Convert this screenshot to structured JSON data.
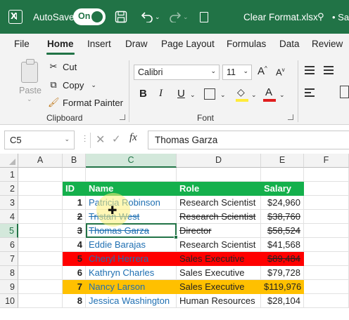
{
  "titlebar": {
    "autosave_label": "AutoSave",
    "autosave_state": "On",
    "filename": "Clear Format.xlsx",
    "saved_label": "• Save"
  },
  "tabs": [
    "File",
    "Home",
    "Insert",
    "Draw",
    "Page Layout",
    "Formulas",
    "Data",
    "Review"
  ],
  "active_tab": "Home",
  "ribbon": {
    "clipboard": {
      "paste_label": "Paste",
      "cut_label": "Cut",
      "copy_label": "Copy",
      "format_painter_label": "Format Painter",
      "group_label": "Clipboard"
    },
    "font": {
      "font_name": "Calibri",
      "font_size": "11",
      "grow_label": "A",
      "shrink_label": "A",
      "bold_label": "B",
      "italic_label": "I",
      "underline_label": "U",
      "fill_color": "#ffeb3b",
      "font_color": "#e01e1e",
      "group_label": "Font"
    }
  },
  "formula_bar": {
    "name_box": "C5",
    "fx_label": "fx",
    "value": "Thomas Garza"
  },
  "grid": {
    "columns": [
      "A",
      "B",
      "C",
      "D",
      "E",
      "F"
    ],
    "rows": [
      "1",
      "2",
      "3",
      "4",
      "5",
      "6",
      "7",
      "8",
      "9",
      "10"
    ],
    "selected_column": "C",
    "selected_row": "5",
    "header": {
      "id": "ID",
      "name": "Name",
      "role": "Role",
      "salary": "Salary"
    },
    "records": [
      {
        "id": "1",
        "name": "Patricia Robinson",
        "role": "Research Scientist",
        "salary": "$24,960"
      },
      {
        "id": "2",
        "name": "Tristan West",
        "role": "Research Scientist",
        "salary": "$38,760"
      },
      {
        "id": "3",
        "name": "Thomas Garza",
        "role": "Director",
        "salary": "$58,524"
      },
      {
        "id": "4",
        "name": "Eddie Barajas",
        "role": "Research Scientist",
        "salary": "$41,568"
      },
      {
        "id": "5",
        "name": "Cheryl Herrera",
        "role": "Sales Executive",
        "salary": "$89,484"
      },
      {
        "id": "6",
        "name": "Kathryn Charles",
        "role": "Sales Executive",
        "salary": "$79,728"
      },
      {
        "id": "7",
        "name": "Nancy Larson",
        "role": "Sales Executive",
        "salary": "$119,976"
      },
      {
        "id": "8",
        "name": "Jessica Washington",
        "role": "Human Resources",
        "salary": "$28,104"
      }
    ],
    "colors": {
      "header_fill": "#14b04c",
      "red_fill": "#ff0000",
      "orange_fill": "#ffc000",
      "name_text": "#1f6fb2"
    }
  }
}
